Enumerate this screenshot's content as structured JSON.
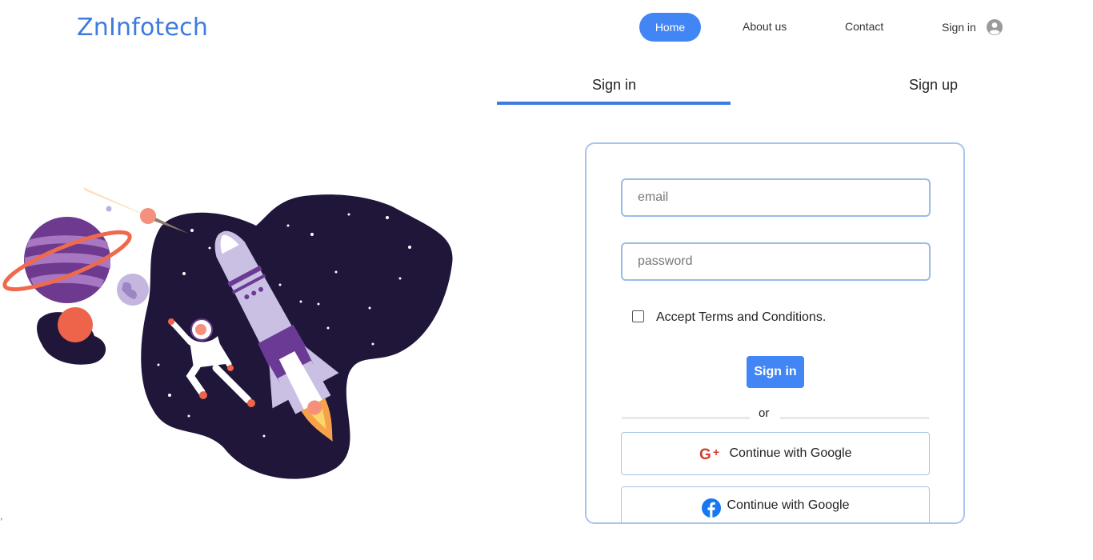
{
  "header": {
    "brand": "ZnInfotech",
    "nav": {
      "home": "Home",
      "about": "About us",
      "contact": "Contact",
      "signin": "Sign in"
    }
  },
  "tabs": {
    "signin": "Sign in",
    "signup": "Sign up"
  },
  "form": {
    "email_placeholder": "email",
    "email_value": "",
    "password_placeholder": "password",
    "password_value": "",
    "terms_label": "Accept Terms and Conditions.",
    "terms_checked": false,
    "submit_label": "Sign in",
    "divider_text": "or",
    "google_label": "Continue with Google",
    "facebook_label": "Continue with Google"
  },
  "footer_mark": ",",
  "colors": {
    "accent": "#4285f4",
    "brand": "#3d7be0",
    "field_border": "#9bbbe8",
    "card_border": "#a9c4ec",
    "space_blob": "#20163a"
  },
  "icons": {
    "user": "user-circle-icon",
    "google": "google-plus-icon",
    "facebook": "facebook-icon"
  }
}
